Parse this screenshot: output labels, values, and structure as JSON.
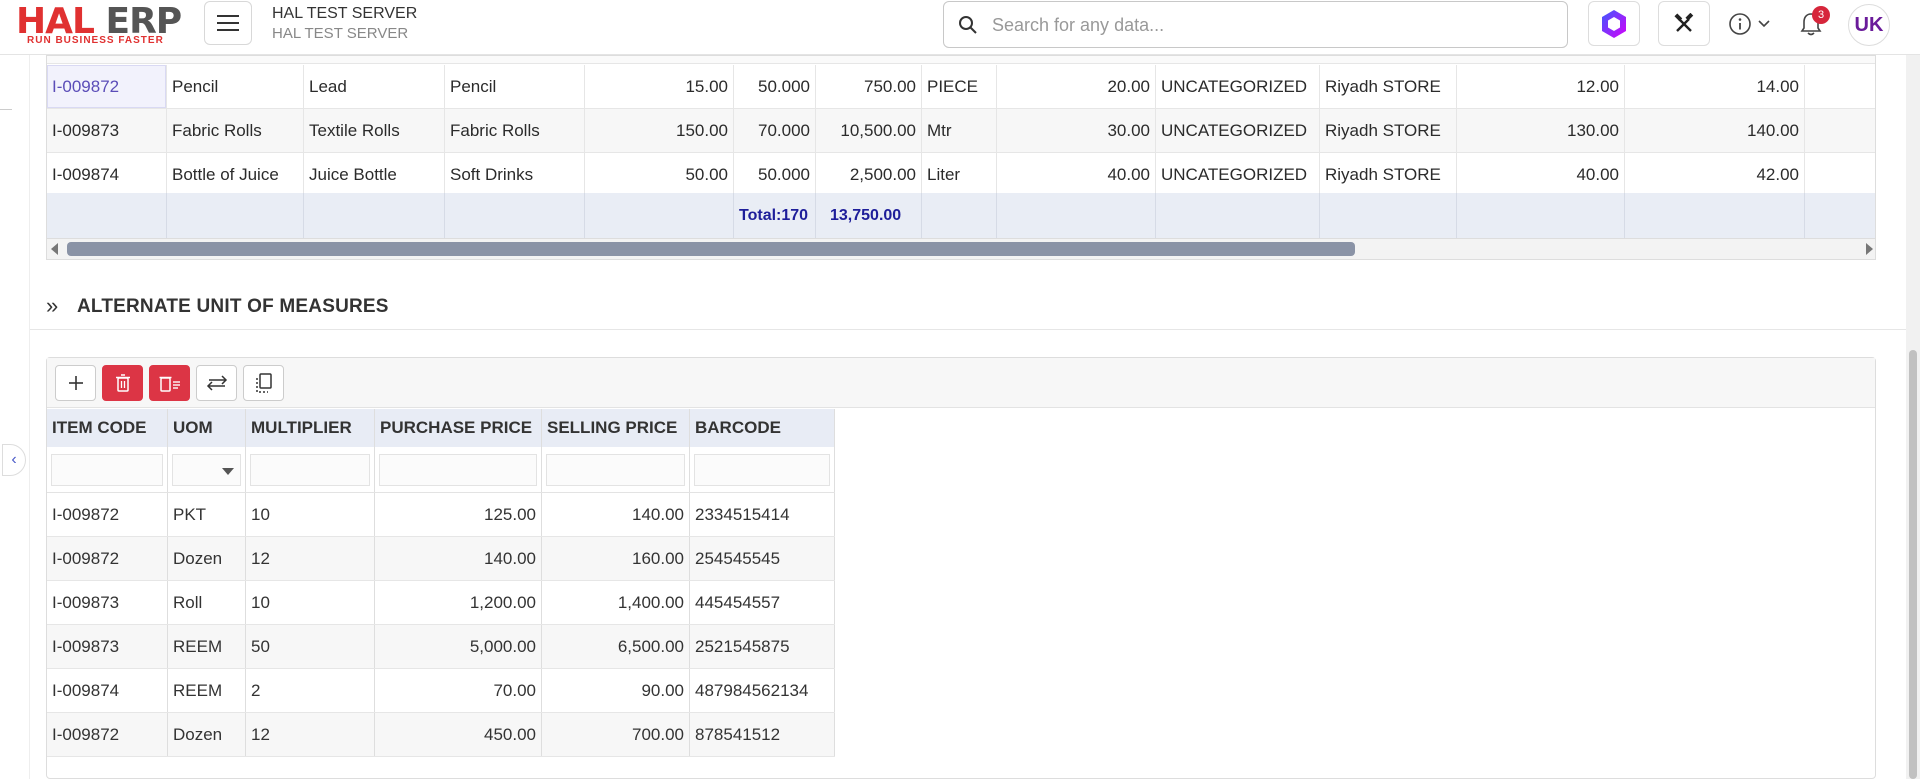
{
  "header": {
    "logo_main_hal": "HAL",
    "logo_main_erp": "ERP",
    "logo_tagline": "RUN BUSINESS FASTER",
    "server_name": "HAL TEST SERVER",
    "server_subtitle": "HAL TEST SERVER",
    "search_placeholder": "Search for any data...",
    "notification_count": "3",
    "avatar_initials": "UK",
    "accent_color": "#e03131"
  },
  "items_grid": {
    "rows": [
      {
        "code": "I-009872",
        "name": "Pencil",
        "alias": "Lead",
        "category": "Pencil",
        "qty": "15.00",
        "rate": "50.000",
        "amount": "750.00",
        "uom": "PIECE",
        "reorder": "20.00",
        "group": "UNCATEGORIZED",
        "store": "Riyadh STORE",
        "min": "12.00",
        "max": "14.00"
      },
      {
        "code": "I-009873",
        "name": "Fabric Rolls",
        "alias": "Textile Rolls",
        "category": "Fabric Rolls",
        "qty": "150.00",
        "rate": "70.000",
        "amount": "10,500.00",
        "uom": "Mtr",
        "reorder": "30.00",
        "group": "UNCATEGORIZED",
        "store": "Riyadh STORE",
        "min": "130.00",
        "max": "140.00"
      },
      {
        "code": "I-009874",
        "name": "Bottle of Juice",
        "alias": "Juice Bottle",
        "category": "Soft Drinks",
        "qty": "50.00",
        "rate": "50.000",
        "amount": "2,500.00",
        "uom": "Liter",
        "reorder": "40.00",
        "group": "UNCATEGORIZED",
        "store": "Riyadh STORE",
        "min": "40.00",
        "max": "42.00"
      }
    ],
    "footer_total_label": "Total:170",
    "footer_amount_total": "13,750.00"
  },
  "section": {
    "title": "ALTERNATE UNIT OF MEASURES"
  },
  "uom_grid": {
    "toolbar": [
      "add-icon",
      "delete-icon",
      "delete-all-icon",
      "swap-icon",
      "copy-icon"
    ],
    "headers": [
      "ITEM CODE",
      "UOM",
      "MULTIPLIER",
      "PURCHASE PRICE",
      "SELLING PRICE",
      "BARCODE"
    ],
    "rows": [
      {
        "code": "I-009872",
        "uom": "PKT",
        "multiplier": "10",
        "purchase": "125.00",
        "selling": "140.00",
        "barcode": "2334515414"
      },
      {
        "code": "I-009872",
        "uom": "Dozen",
        "multiplier": "12",
        "purchase": "140.00",
        "selling": "160.00",
        "barcode": "254545545"
      },
      {
        "code": "I-009873",
        "uom": "Roll",
        "multiplier": "10",
        "purchase": "1,200.00",
        "selling": "1,400.00",
        "barcode": "445454557"
      },
      {
        "code": "I-009873",
        "uom": "REEM",
        "multiplier": "50",
        "purchase": "5,000.00",
        "selling": "6,500.00",
        "barcode": "2521545875"
      },
      {
        "code": "I-009874",
        "uom": "REEM",
        "multiplier": "2",
        "purchase": "70.00",
        "selling": "90.00",
        "barcode": "487984562134"
      },
      {
        "code": "I-009872",
        "uom": "Dozen",
        "multiplier": "12",
        "purchase": "450.00",
        "selling": "700.00",
        "barcode": "878541512"
      }
    ]
  }
}
